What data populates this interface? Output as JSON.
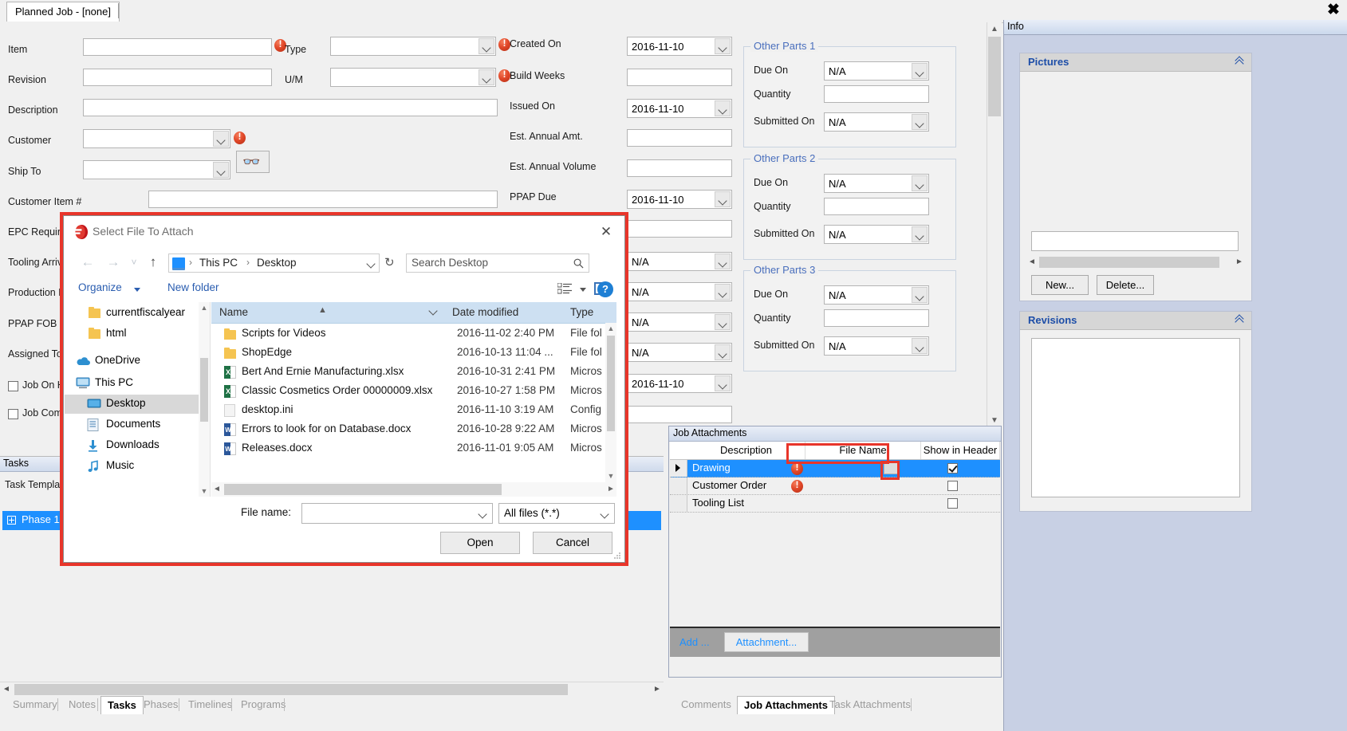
{
  "window": {
    "tab_title": "Planned Job - [none]",
    "close_label": "✖"
  },
  "form": {
    "left_fields": [
      {
        "label": "Item",
        "value": "",
        "type": "text"
      },
      {
        "label": "Revision",
        "value": "",
        "type": "text"
      },
      {
        "label": "Description",
        "value": "",
        "type": "text"
      },
      {
        "label": "Customer",
        "value": "",
        "type": "combo"
      },
      {
        "label": "Ship To",
        "value": "",
        "type": "combo"
      },
      {
        "label": "Customer Item #",
        "value": "",
        "type": "text"
      },
      {
        "label": "EPC Required",
        "value": "",
        "type": "text"
      },
      {
        "label": "Tooling Arrival",
        "value": "",
        "type": "text"
      },
      {
        "label": "Production Fa",
        "value": "",
        "type": "text"
      },
      {
        "label": "PPAP FOB",
        "value": "",
        "type": "text"
      },
      {
        "label": "Assigned To",
        "value": "",
        "type": "text"
      }
    ],
    "mid_fields": [
      {
        "label": "Type",
        "value": "",
        "type": "combo"
      },
      {
        "label": "U/M",
        "value": "",
        "type": "combo"
      }
    ],
    "right_fields": [
      {
        "label": "Created On",
        "value": "2016-11-10",
        "type": "combo"
      },
      {
        "label": "Build Weeks",
        "value": "",
        "type": "text"
      },
      {
        "label": "Issued On",
        "value": "2016-11-10",
        "type": "combo"
      },
      {
        "label": "Est. Annual Amt.",
        "value": "",
        "type": "text"
      },
      {
        "label": "Est. Annual Volume",
        "value": "",
        "type": "text"
      },
      {
        "label": "PPAP Due",
        "value": "2016-11-10",
        "type": "combo"
      },
      {
        "label": "",
        "value": "",
        "type": "text"
      },
      {
        "label": "",
        "value": "N/A",
        "type": "combo"
      },
      {
        "label": "",
        "value": "N/A",
        "type": "combo"
      },
      {
        "label": "",
        "value": "N/A",
        "type": "combo"
      },
      {
        "label": "",
        "value": "N/A",
        "type": "combo"
      },
      {
        "label": "",
        "value": "2016-11-10",
        "type": "combo"
      }
    ],
    "checkboxes": [
      {
        "label": "Job On Ho",
        "checked": false
      },
      {
        "label": "Job Comp",
        "checked": false
      }
    ],
    "search_icon": "binoculars-icon"
  },
  "other_parts": [
    {
      "title": "Other Parts 1",
      "fields": [
        {
          "label": "Due On",
          "value": "N/A",
          "type": "combo"
        },
        {
          "label": "Quantity",
          "value": "",
          "type": "text"
        },
        {
          "label": "Submitted On",
          "value": "N/A",
          "type": "combo"
        }
      ]
    },
    {
      "title": "Other Parts 2",
      "fields": [
        {
          "label": "Due On",
          "value": "N/A",
          "type": "combo"
        },
        {
          "label": "Quantity",
          "value": "",
          "type": "text"
        },
        {
          "label": "Submitted On",
          "value": "N/A",
          "type": "combo"
        }
      ]
    },
    {
      "title": "Other Parts 3",
      "fields": [
        {
          "label": "Due On",
          "value": "N/A",
          "type": "combo"
        },
        {
          "label": "Quantity",
          "value": "",
          "type": "text"
        },
        {
          "label": "Submitted On",
          "value": "N/A",
          "type": "combo"
        }
      ]
    }
  ],
  "tasks": {
    "title": "Tasks",
    "template_label": "Task Template",
    "phase_row": "Phase 1"
  },
  "bottom_tabs_left": {
    "items": [
      "Summary",
      "Notes",
      "Tasks",
      "Phases",
      "Timelines",
      "Programs"
    ],
    "selected": "Tasks"
  },
  "job_attachments": {
    "title": "Job Attachments",
    "columns": [
      "Description",
      "File Name",
      "Show in Header"
    ],
    "rows": [
      {
        "description": "Drawing",
        "file_name": "",
        "show_in_header": true,
        "selected": true,
        "has_error": true
      },
      {
        "description": "Customer Order",
        "file_name": "",
        "show_in_header": false,
        "selected": false,
        "has_error": true
      },
      {
        "description": "Tooling List",
        "file_name": "",
        "show_in_header": false,
        "selected": false,
        "has_error": false
      }
    ],
    "add_label": "Add ...",
    "attachment_label": "Attachment..."
  },
  "bottom_tabs_right": {
    "items": [
      "Comments",
      "Job Attachments",
      "Task Attachments"
    ],
    "selected": "Job Attachments"
  },
  "info_panel": {
    "title": "Info",
    "pictures": {
      "title": "Pictures",
      "caption_value": "",
      "new_label": "New...",
      "delete_label": "Delete..."
    },
    "revisions": {
      "title": "Revisions"
    }
  },
  "file_dialog": {
    "title": "Select File To Attach",
    "close_label": "✕",
    "nav": {
      "back": "←",
      "forward": "→",
      "recent": "˅",
      "up": "↑",
      "refresh": "↻"
    },
    "breadcrumbs": [
      "This PC",
      "Desktop"
    ],
    "search_placeholder": "Search Desktop",
    "toolbar": {
      "organize": "Organize",
      "new_folder": "New folder",
      "help": "?"
    },
    "nav_items": [
      {
        "label": "currentfiscalyear",
        "icon": "folder-icon",
        "indent": 30,
        "selected": false
      },
      {
        "label": "html",
        "icon": "folder-icon",
        "indent": 30,
        "selected": false
      },
      {
        "label": "OneDrive",
        "icon": "onedrive-icon",
        "indent": 14,
        "selected": false
      },
      {
        "label": "This PC",
        "icon": "pc-icon",
        "indent": 14,
        "selected": false
      },
      {
        "label": "Desktop",
        "icon": "desktop-icon",
        "indent": 30,
        "selected": true
      },
      {
        "label": "Documents",
        "icon": "documents-icon",
        "indent": 30,
        "selected": false
      },
      {
        "label": "Downloads",
        "icon": "downloads-icon",
        "indent": 30,
        "selected": false
      },
      {
        "label": "Music",
        "icon": "music-icon",
        "indent": 30,
        "selected": false
      }
    ],
    "columns": [
      "Name",
      "Date modified",
      "Type"
    ],
    "files": [
      {
        "name": "Scripts for Videos",
        "date": "2016-11-02 2:40 PM",
        "type": "File fol",
        "icon": "folder-icon"
      },
      {
        "name": "ShopEdge",
        "date": "2016-10-13 11:04 ...",
        "type": "File fol",
        "icon": "folder-icon"
      },
      {
        "name": "Bert And Ernie Manufacturing.xlsx",
        "date": "2016-10-31 2:41 PM",
        "type": "Micros",
        "icon": "excel-icon"
      },
      {
        "name": "Classic Cosmetics Order 00000009.xlsx",
        "date": "2016-10-27 1:58 PM",
        "type": "Micros",
        "icon": "excel-icon"
      },
      {
        "name": "desktop.ini",
        "date": "2016-11-10 3:19 AM",
        "type": "Config",
        "icon": "ini-icon"
      },
      {
        "name": "Errors to look for on Database.docx",
        "date": "2016-10-28 9:22 AM",
        "type": "Micros",
        "icon": "word-icon"
      },
      {
        "name": "Releases.docx",
        "date": "2016-11-01 9:05 AM",
        "type": "Micros",
        "icon": "word-icon"
      }
    ],
    "file_name_label": "File name:",
    "file_name_value": "",
    "file_type_value": "All files (*.*)",
    "open_label": "Open",
    "cancel_label": "Cancel"
  }
}
